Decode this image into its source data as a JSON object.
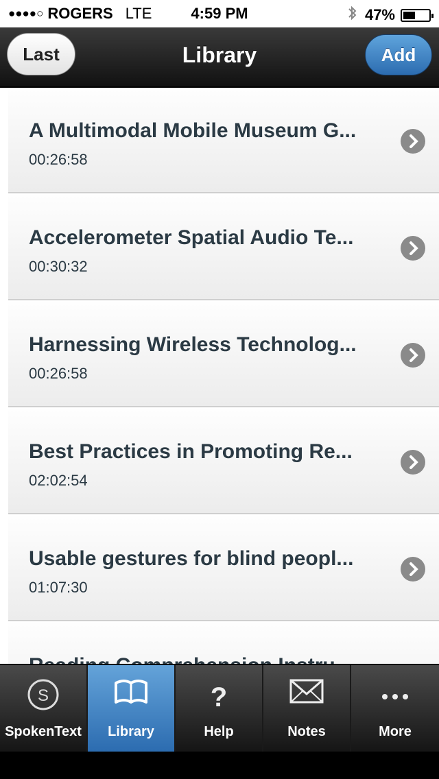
{
  "status_bar": {
    "signal": "●●●●○",
    "carrier": "ROGERS",
    "network": "LTE",
    "time": "4:59 PM",
    "battery_pct": "47%",
    "battery_level": 0.47
  },
  "header": {
    "title": "Library",
    "left_button": "Last",
    "right_button": "Add"
  },
  "list": {
    "items": [
      {
        "title": "A Multimodal Mobile Museum G...",
        "duration": "00:26:58"
      },
      {
        "title": "Accelerometer Spatial Audio Te...",
        "duration": "00:30:32"
      },
      {
        "title": "Harnessing Wireless Technolog...",
        "duration": "00:26:58"
      },
      {
        "title": "Best Practices in Promoting Re...",
        "duration": "02:02:54"
      },
      {
        "title": "Usable gestures for blind peopl...",
        "duration": "01:07:30"
      },
      {
        "title": "Reading Comprehension Instru...",
        "duration": ""
      }
    ]
  },
  "tabs": [
    {
      "label": "SpokenText",
      "icon": "spokentext-s-icon"
    },
    {
      "label": "Library",
      "icon": "book-icon",
      "active": true
    },
    {
      "label": "Help",
      "icon": "question-icon"
    },
    {
      "label": "Notes",
      "icon": "envelope-icon"
    },
    {
      "label": "More",
      "icon": "more-dots-icon"
    }
  ],
  "colors": {
    "accent_blue": "#2c6cb0",
    "text_dark": "#2b3a44"
  }
}
